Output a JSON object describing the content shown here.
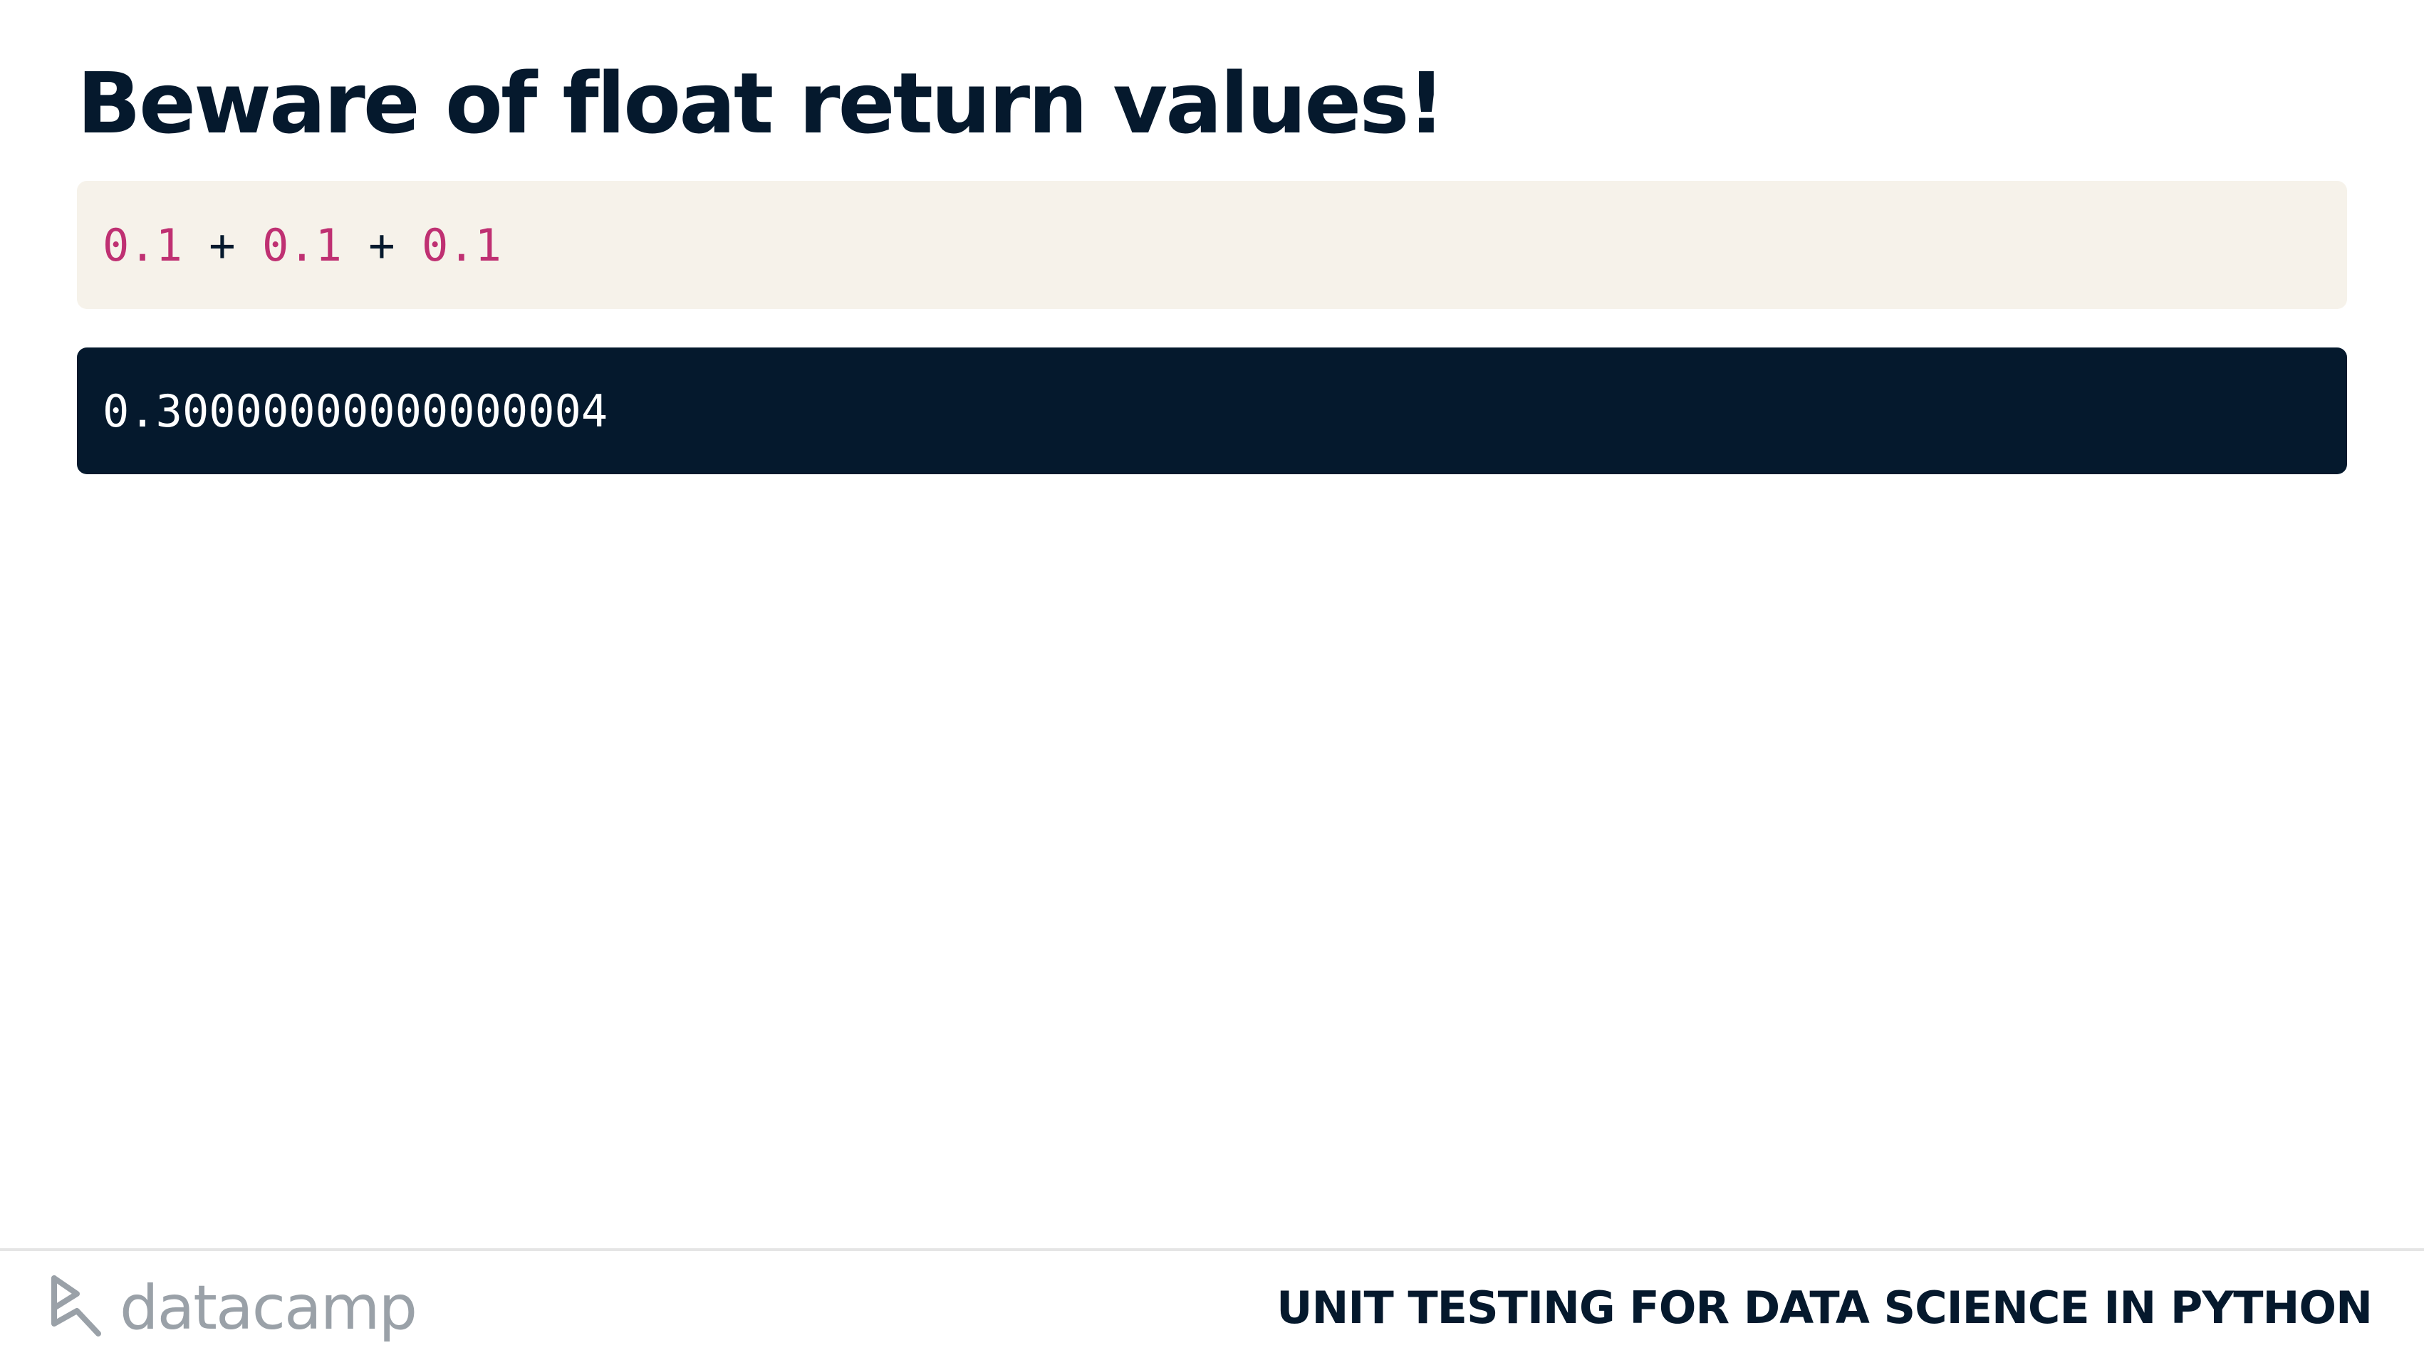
{
  "slide": {
    "title": "Beware of float return values!"
  },
  "code_input": {
    "tokens": [
      "0.1",
      " + ",
      "0.1",
      " + ",
      "0.1"
    ]
  },
  "code_output": {
    "text": "0.30000000000000004"
  },
  "footer": {
    "logo_text": "datacamp",
    "course_title": "UNIT TESTING FOR DATA SCIENCE IN PYTHON"
  },
  "colors": {
    "title": "#05192d",
    "input_bg": "#f6f2ea",
    "output_bg": "#05192d",
    "number_literal": "#bf3072",
    "logo": "#9aa1a8"
  }
}
